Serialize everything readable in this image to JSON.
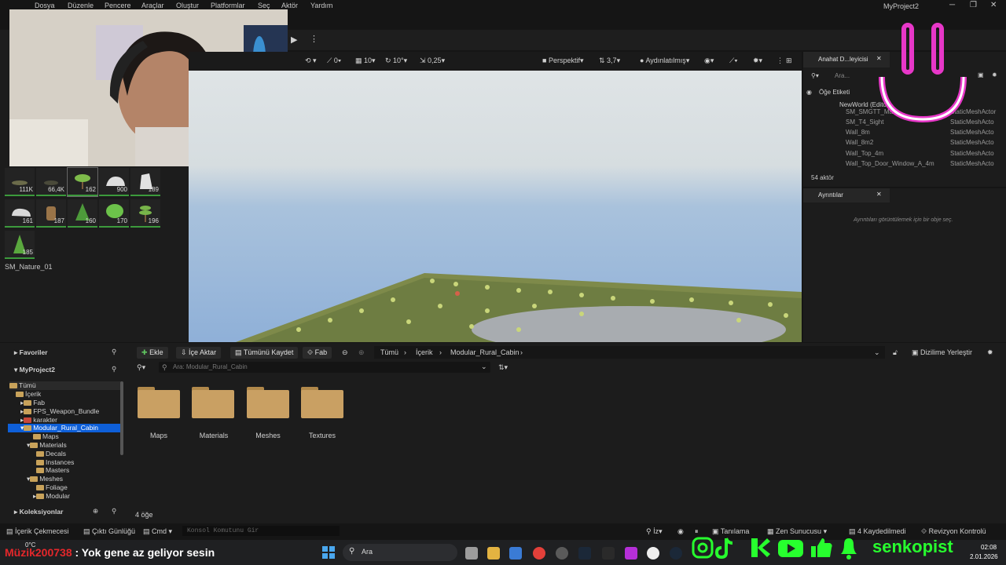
{
  "window": {
    "title": "MyProject2"
  },
  "menu": [
    "Dosya",
    "Düzenle",
    "Pencere",
    "Araçlar",
    "Oluştur",
    "Platformlar",
    "Seç",
    "Aktör",
    "Yardım"
  ],
  "viewport": {
    "snap_rot": "0",
    "snap_grid": "10",
    "snap_angle": "10°",
    "snap_scale": "0,25",
    "view_mode": "Perspektif",
    "cam_speed": "3,7",
    "lighting": "Aydınlatılmış"
  },
  "foliage_tiles": [
    {
      "count": "111K"
    },
    {
      "count": "66,4K"
    },
    {
      "count": "162"
    },
    {
      "count": "900"
    },
    {
      "count": "189"
    },
    {
      "count": "161"
    },
    {
      "count": "187"
    },
    {
      "count": "160"
    },
    {
      "count": "170"
    },
    {
      "count": "196"
    },
    {
      "count": "185"
    }
  ],
  "foliage_label": "SM_Nature_01",
  "outliner": {
    "tab_label": "Anahat D...leyicisi",
    "search_placeholder": "Ara...",
    "col_label": "Öğe Etiketi",
    "world": "NewWorld (Editor)",
    "rows": [
      {
        "name": "SM_SMGTT_Ma...",
        "type": "StaticMeshActor"
      },
      {
        "name": "SM_T4_Sight",
        "type": "StaticMeshActo"
      },
      {
        "name": "Wall_8m",
        "type": "StaticMeshActo"
      },
      {
        "name": "Wall_8m2",
        "type": "StaticMeshActo"
      },
      {
        "name": "Wall_Top_4m",
        "type": "StaticMeshActo"
      },
      {
        "name": "Wall_Top_Door_Window_A_4m",
        "type": "StaticMeshActo"
      }
    ],
    "actor_count": "54 aktör"
  },
  "details": {
    "tab_label": "Ayrıntılar",
    "empty_text": "Ayrıntıları görüntülemek için bir obje seç."
  },
  "content_browser": {
    "favorites": "Favoriler",
    "project": "MyProject2",
    "collections": "Koleksiyonlar",
    "add_label": "Ekle",
    "import_label": "İçe Aktar",
    "save_all_label": "Tümünü Kaydet",
    "fab_label": "Fab",
    "breadcrumb": [
      "Tümü",
      "İçerik",
      "Modular_Rural_Cabin"
    ],
    "dock_label": "Dizilime Yerleştir",
    "search_placeholder": "Ara: Modular_Rural_Cabin",
    "tree": [
      {
        "label": "Tümü"
      },
      {
        "label": "İçerik"
      },
      {
        "label": "Fab"
      },
      {
        "label": "FPS_Weapon_Bundle"
      },
      {
        "label": "karakter"
      },
      {
        "label": "Modular_Rural_Cabin"
      },
      {
        "label": "Maps"
      },
      {
        "label": "Materials"
      },
      {
        "label": "Decals"
      },
      {
        "label": "Instances"
      },
      {
        "label": "Masters"
      },
      {
        "label": "Meshes"
      },
      {
        "label": "Foliage"
      },
      {
        "label": "Modular"
      }
    ],
    "folders": [
      {
        "label": "Maps"
      },
      {
        "label": "Materials"
      },
      {
        "label": "Meshes"
      },
      {
        "label": "Textures"
      }
    ],
    "item_count": "4 öğe"
  },
  "statusbar": {
    "content_drawer": "İçerik Çekmecesi",
    "output_log": "Çıktı Günlüğü",
    "cmd": "Cmd",
    "console_placeholder": "Konsol Komutunu Gir",
    "trace": "İz",
    "derived": "Tanılama",
    "zen": "Zen Sunucusu",
    "saved": "4 Kaydedilmedi",
    "revision": "Revizyon Kontrolü"
  },
  "taskbar": {
    "search": "Ara",
    "time": "02:08",
    "date": "2.01.2026",
    "temp": "0°C"
  },
  "chat": {
    "user": "Müzik200738",
    "message": ": Yok gene az geliyor sesin"
  },
  "brand": "senkopist",
  "colors": {
    "accent_blue": "#0e5fd8",
    "brand_green": "#27ff2e",
    "smiley_pink": "#e737c8",
    "folder": "#c9a063"
  }
}
